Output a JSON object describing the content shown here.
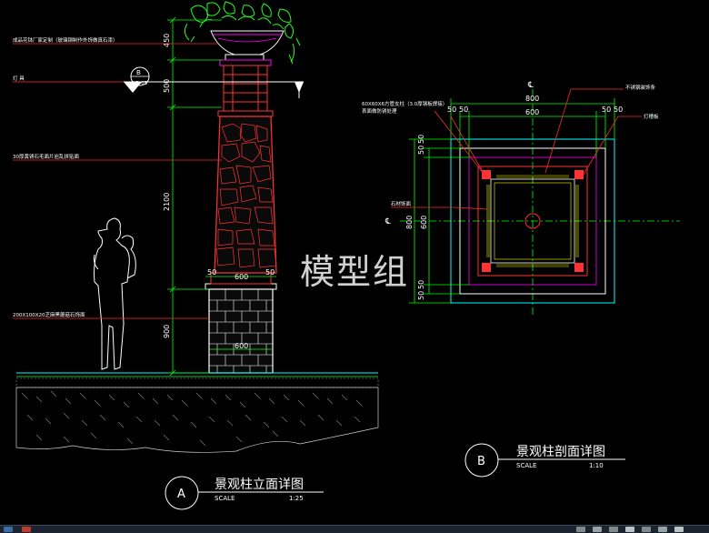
{
  "elevation": {
    "title": "景观柱立面详图",
    "scale_label": "SCALE",
    "scale_value": "1:25",
    "callout": "A",
    "section_marker": {
      "letter": "B",
      "ref": "LD-03"
    },
    "dims_vertical": [
      "450",
      "500",
      "2100",
      "900"
    ],
    "dims_horizontal": [
      "50",
      "600",
      "50",
      "600"
    ],
    "notes": [
      "成品花钵厂家定制（玻璃钢制作外饰做真石漆）",
      "灯 具",
      "30厚黄锈石毛面片岩乱拼贴面",
      "200X100X20芝麻黑蘑菇石饰面"
    ]
  },
  "section": {
    "title": "景观柱剖面详图",
    "scale_label": "SCALE",
    "scale_value": "1:10",
    "callout": "B",
    "centerline": "℄",
    "dims_top": [
      "800",
      "600",
      "50",
      "50",
      "50",
      "50"
    ],
    "dims_left": [
      "50",
      "50",
      "800",
      "600",
      "50",
      "50"
    ],
    "notes": [
      "60X60X6方管支柱（3.0厚钢板焊接）",
      "表面做防锈处理",
      "不锈钢装饰条",
      "灯槽板",
      "石材饰面"
    ]
  },
  "watermark": "模型组",
  "colors": {
    "background": "#000000",
    "dimension": "#00ff00",
    "leader": "#ff2a2a",
    "linework": "#ffffff",
    "accent": "#ff00ff",
    "cyan": "#00ffff",
    "yellow": "#ffff00",
    "stone": "#ff3333"
  }
}
